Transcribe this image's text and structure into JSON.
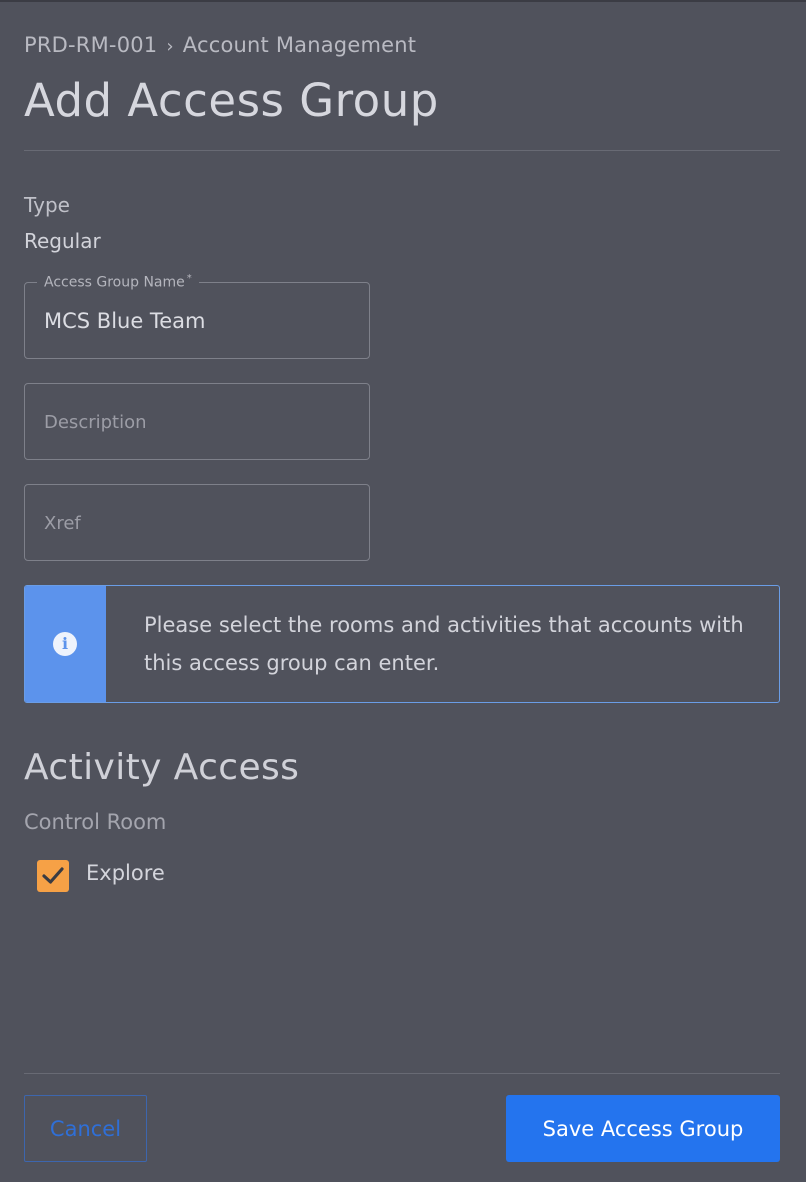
{
  "breadcrumb": {
    "parent": "PRD-RM-001",
    "separator": "›",
    "current": "Account Management"
  },
  "page": {
    "title": "Add Access Group"
  },
  "type": {
    "label": "Type",
    "value": "Regular"
  },
  "form": {
    "name": {
      "label": "Access Group Name",
      "required_mark": "*",
      "value": "MCS Blue Team"
    },
    "description": {
      "placeholder": "Description",
      "value": ""
    },
    "xref": {
      "placeholder": "Xref",
      "value": ""
    }
  },
  "info": {
    "icon": "info-icon",
    "icon_glyph": "i",
    "message": "Please select the rooms and activities that accounts with this access group can enter."
  },
  "activity_access": {
    "title": "Activity Access",
    "room": "Control Room",
    "activities": [
      {
        "label": "Explore",
        "checked": true
      }
    ]
  },
  "actions": {
    "cancel_label": "Cancel",
    "save_label": "Save Access Group"
  },
  "colors": {
    "background": "#50525c",
    "accent": "#2474ee",
    "info_stripe": "#5c93ec",
    "checkbox": "#f6a146"
  }
}
